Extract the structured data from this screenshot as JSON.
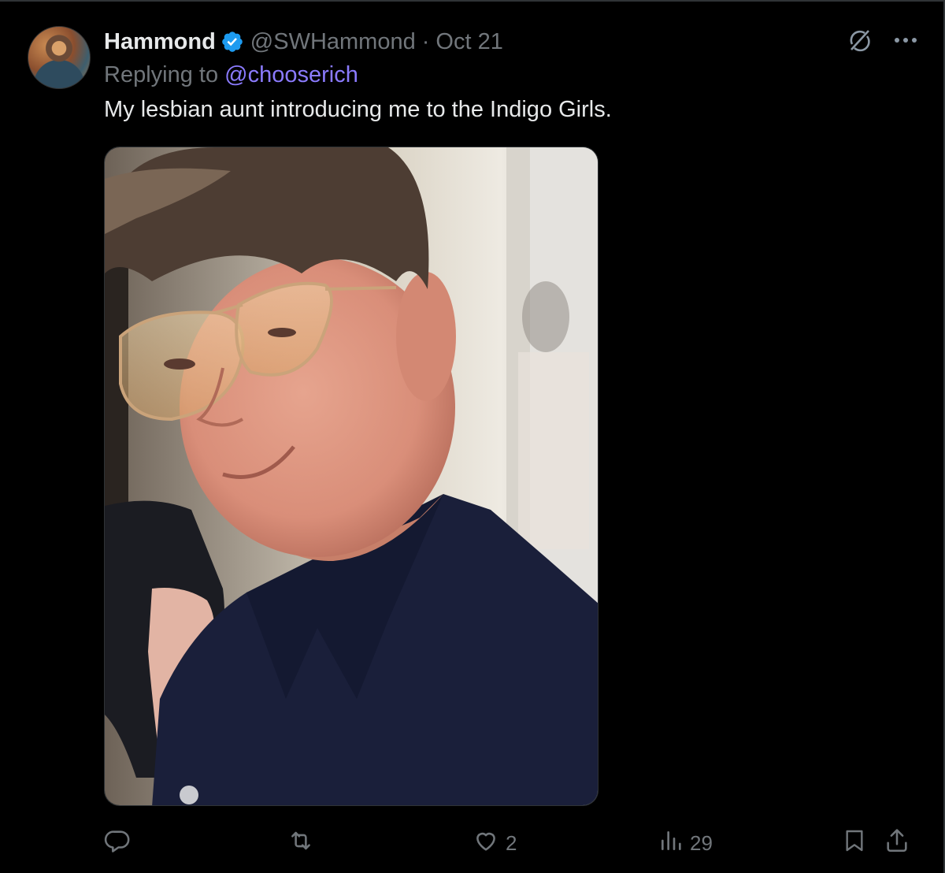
{
  "tweet": {
    "author": {
      "display_name": "Hammond",
      "verified": true,
      "handle": "@SWHammond",
      "date": "Oct 21",
      "separator": "·"
    },
    "reply": {
      "prefix": "Replying to",
      "handle": "@chooserich"
    },
    "text": "My lesbian aunt introducing me to the Indigo Girls.",
    "media": {
      "type": "photo",
      "description_icon": "photo"
    },
    "stats": {
      "replies": "",
      "reposts": "",
      "likes": "2",
      "views": "29"
    },
    "icons": {
      "grok": "grok-icon",
      "more": "more-icon",
      "reply": "reply-icon",
      "repost": "repost-icon",
      "like": "heart-icon",
      "views": "views-icon",
      "bookmark": "bookmark-icon",
      "share": "share-icon"
    },
    "colors": {
      "background": "#000000",
      "text": "#e7e9ea",
      "muted": "#71767b",
      "link": "#8b7bff",
      "verified": "#1d9bf0"
    }
  }
}
